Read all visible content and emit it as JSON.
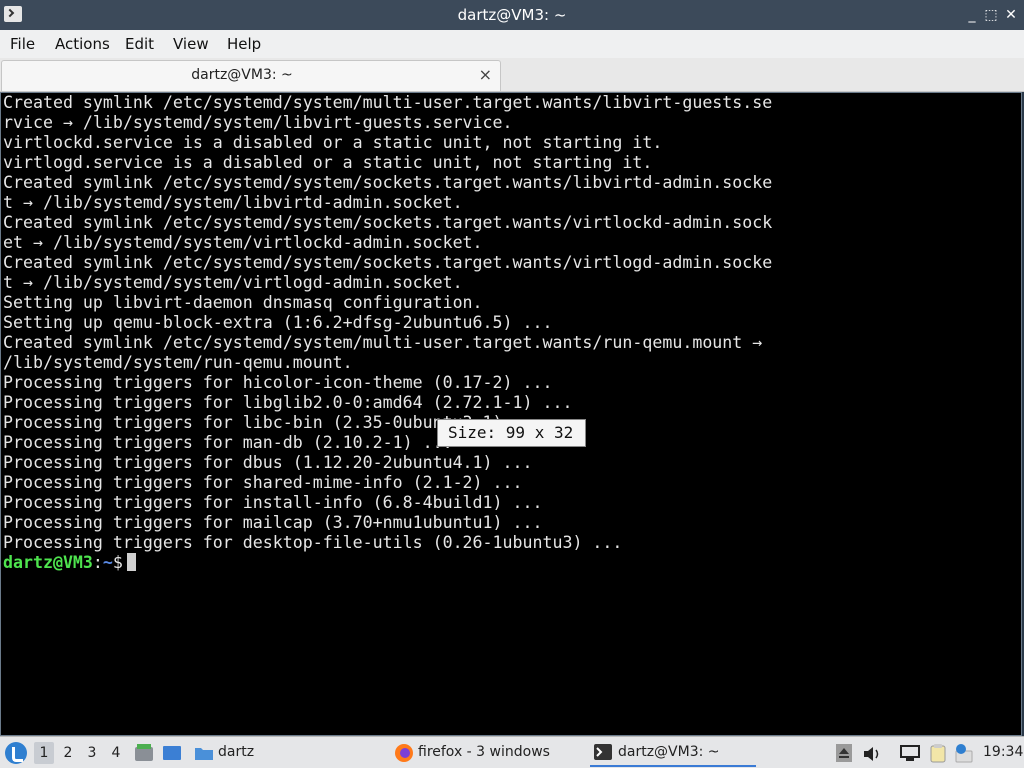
{
  "window": {
    "title": "dartz@VM3: ~",
    "controls": {
      "minimize": "_",
      "maximize": "⬚",
      "close": "✕"
    }
  },
  "menubar": {
    "items": [
      "File",
      "Actions",
      "Edit",
      "View",
      "Help"
    ]
  },
  "tab": {
    "title": "dartz@VM3: ~",
    "close": "×"
  },
  "terminal": {
    "lines": [
      "Created symlink /etc/systemd/system/multi-user.target.wants/libvirt-guests.se",
      "rvice → /lib/systemd/system/libvirt-guests.service.",
      "virtlockd.service is a disabled or a static unit, not starting it.",
      "virtlogd.service is a disabled or a static unit, not starting it.",
      "Created symlink /etc/systemd/system/sockets.target.wants/libvirtd-admin.socke",
      "t → /lib/systemd/system/libvirtd-admin.socket.",
      "Created symlink /etc/systemd/system/sockets.target.wants/virtlockd-admin.sock",
      "et → /lib/systemd/system/virtlockd-admin.socket.",
      "Created symlink /etc/systemd/system/sockets.target.wants/virtlogd-admin.socke",
      "t → /lib/systemd/system/virtlogd-admin.socket.",
      "Setting up libvirt-daemon dnsmasq configuration.",
      "Setting up qemu-block-extra (1:6.2+dfsg-2ubuntu6.5) ...",
      "Created symlink /etc/systemd/system/multi-user.target.wants/run-qemu.mount →",
      "/lib/systemd/system/run-qemu.mount.",
      "Processing triggers for hicolor-icon-theme (0.17-2) ...",
      "Processing triggers for libglib2.0-0:amd64 (2.72.1-1) ...",
      "Processing triggers for libc-bin (2.35-0ubuntu3.1) ...",
      "Processing triggers for man-db (2.10.2-1) ...",
      "Processing triggers for dbus (1.12.20-2ubuntu4.1) ...",
      "Processing triggers for shared-mime-info (2.1-2) ...",
      "Processing triggers for install-info (6.8-4build1) ...",
      "Processing triggers for mailcap (3.70+nmu1ubuntu1) ...",
      "Processing triggers for desktop-file-utils (0.26-1ubuntu3) ..."
    ],
    "prompt": {
      "user_host": "dartz@VM3",
      "separator": ":",
      "path": "~",
      "symbol": "$"
    },
    "size_tooltip": "Size: 99 x 32"
  },
  "taskbar": {
    "workspaces": [
      "1",
      "2",
      "3",
      "4"
    ],
    "active_workspace": "1",
    "folder_label": "dartz",
    "firefox_label": "firefox - 3 windows",
    "terminal_label": "dartz@VM3: ~",
    "clock": "19:34"
  },
  "colors": {
    "terminal_bg": "#000000",
    "prompt_user": "#4ee44e",
    "prompt_path": "#5a8ae6",
    "titlebar": "#3c4a5a"
  }
}
